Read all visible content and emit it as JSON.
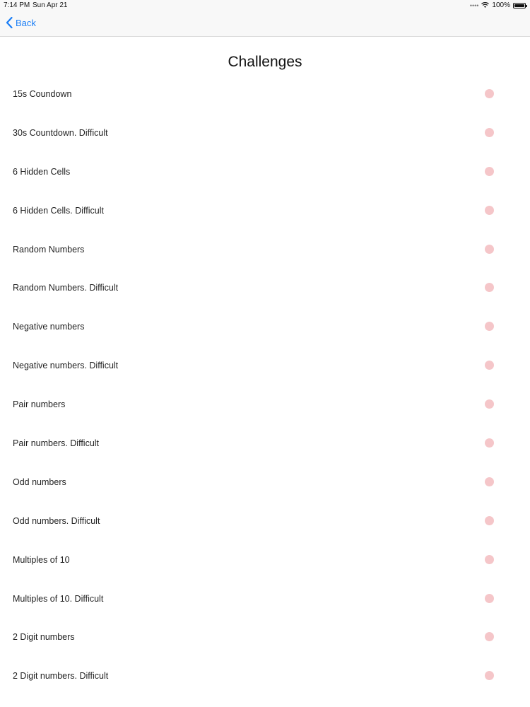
{
  "status_bar": {
    "time": "7:14 PM",
    "date": "Sun Apr 21",
    "battery": "100%"
  },
  "nav": {
    "back_label": "Back",
    "back_color": "#1a7ef6"
  },
  "title": "Challenges",
  "incomplete_color": "#f5c6c9",
  "challenges": [
    {
      "label": "15s Coundown"
    },
    {
      "label": "30s Countdown. Difficult"
    },
    {
      "label": "6 Hidden Cells"
    },
    {
      "label": "6 Hidden Cells. Difficult"
    },
    {
      "label": "Random Numbers"
    },
    {
      "label": "Random Numbers. Difficult"
    },
    {
      "label": "Negative numbers"
    },
    {
      "label": "Negative numbers. Difficult"
    },
    {
      "label": "Pair numbers"
    },
    {
      "label": "Pair numbers. Difficult"
    },
    {
      "label": "Odd numbers"
    },
    {
      "label": "Odd numbers. Difficult"
    },
    {
      "label": "Multiples of 10"
    },
    {
      "label": "Multiples of 10. Difficult"
    },
    {
      "label": "2 Digit numbers"
    },
    {
      "label": "2 Digit numbers. Difficult"
    }
  ]
}
